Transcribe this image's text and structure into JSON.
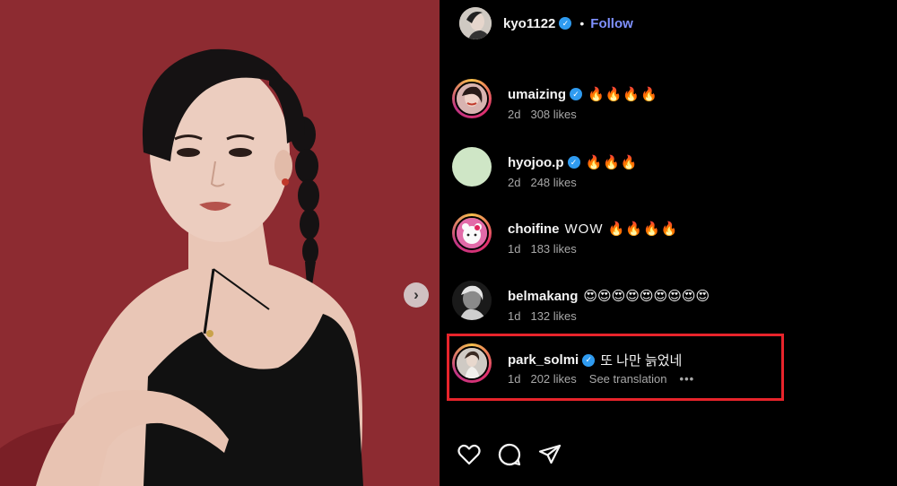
{
  "post": {
    "author": "kyo1122",
    "verified": true,
    "separator": "•",
    "follow_label": "Follow"
  },
  "photo": {
    "subject": "portrait of a woman in a black halter dress against a red backdrop",
    "next_icon": "chevron-right-icon"
  },
  "comments": [
    {
      "username": "umaizing",
      "verified": true,
      "text": "🔥🔥🔥🔥",
      "age": "2d",
      "likes": "308 likes"
    },
    {
      "username": "hyojoo.p",
      "verified": true,
      "text": "🔥🔥🔥",
      "age": "2d",
      "likes": "248 likes"
    },
    {
      "username": "choifine",
      "verified": false,
      "text": "WOW 🔥🔥🔥🔥",
      "age": "1d",
      "likes": "183 likes"
    },
    {
      "username": "belmakang",
      "verified": false,
      "text": "😍😍😍😍😍😍😍😍😍",
      "age": "1d",
      "likes": "132 likes"
    },
    {
      "username": "park_solmi",
      "verified": true,
      "text": "또 나만 늙었네",
      "age": "1d",
      "likes": "202 likes",
      "see_translation": "See translation",
      "more": "•••"
    }
  ],
  "actions": {
    "like_icon": "heart-icon",
    "comment_icon": "comment-bubble-icon",
    "share_icon": "paper-plane-icon"
  },
  "colors": {
    "backdrop": "#8d2b31",
    "panel_bg": "#000000",
    "verified_badge": "#2f9bf0",
    "follow_link": "#7f91ff",
    "highlight_box": "#e8242b",
    "meta_text": "#a8a8a8"
  }
}
